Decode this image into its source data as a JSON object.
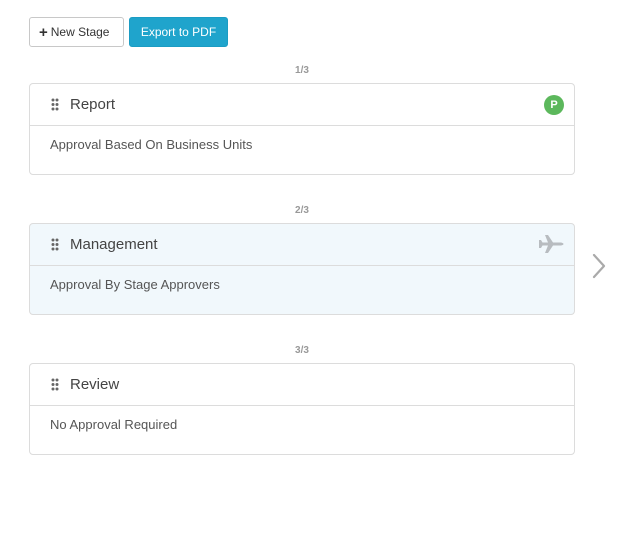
{
  "toolbar": {
    "new_stage_label": "New Stage",
    "export_label": "Export to PDF"
  },
  "colors": {
    "primary": "#1fa4cc",
    "badge_green": "#5cb85c",
    "active_stage_bg": "#f1f8fc"
  },
  "stages": [
    {
      "counter": "1/3",
      "title": "Report",
      "description": "Approval Based On Business Units",
      "badge": "P",
      "icon": "drag-handle-icon"
    },
    {
      "counter": "2/3",
      "title": "Management",
      "description": "Approval By Stage Approvers",
      "icon": "airplane-icon"
    },
    {
      "counter": "3/3",
      "title": "Review",
      "description": "No Approval Required"
    }
  ],
  "navigation": {
    "next_icon": "chevron-right-icon"
  }
}
